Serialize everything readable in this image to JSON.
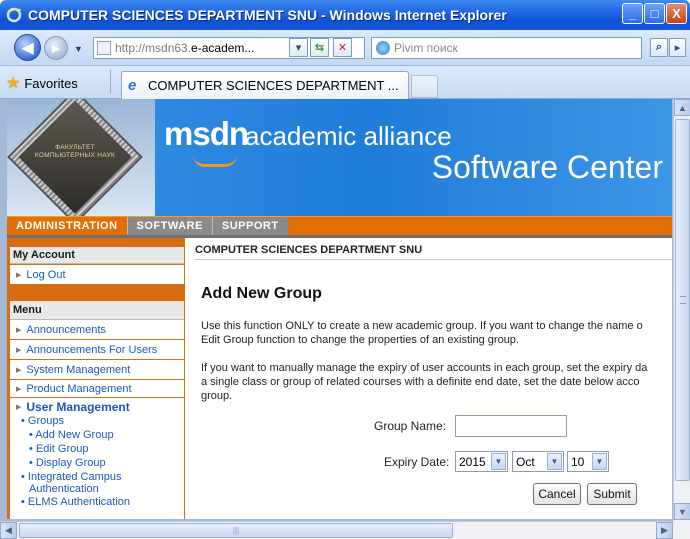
{
  "window": {
    "title": "COMPUTER SCIENCES DEPARTMENT SNU - Windows Internet Explorer",
    "buttons": [
      "_",
      "□",
      "X"
    ]
  },
  "nav": {
    "address_prefix": "http://msdn63.",
    "address_host": "e-academ...",
    "search_placeholder": "Pivim поиск"
  },
  "favorites": {
    "label": "Favorites",
    "tab_title": "COMPUTER SCIENCES DEPARTMENT ..."
  },
  "banner": {
    "logo_text": "ФАКУЛЬТЕТ КОМПЬЮТЕРНЫХ НАУК",
    "msdn": "msdn",
    "academic_alliance": "academic alliance",
    "software_center": "Software Center"
  },
  "topnav": {
    "items": [
      "ADMINISTRATION",
      "SOFTWARE",
      "SUPPORT"
    ]
  },
  "sidebar": {
    "my_account_header": "My Account",
    "logout": "Log Out",
    "menu_header": "Menu",
    "items": [
      "Announcements",
      "Announcements For Users",
      "System Management",
      "Product Management"
    ],
    "user_management": "User Management",
    "groups": "• Groups",
    "group_links": [
      "• Add New Group",
      "• Edit Group",
      "• Display Group"
    ],
    "integrated_campus": [
      "• Integrated Campus",
      "Authentication"
    ],
    "elms": "• ELMS Authentication"
  },
  "main": {
    "breadcrumb": "COMPUTER SCIENCES DEPARTMENT SNU",
    "title": "Add New Group",
    "para1_line1": "Use this function ONLY to create a new academic group. If you want to change the name o",
    "para1_line2": "Edit Group function to change the properties of an existing group.",
    "para2_line1": "If you want to manually manage the expiry of user accounts in each group, set the expiry da",
    "para2_line2": "a single class or group of related courses with a definite end date, set the date below acco",
    "para2_line3": "group.",
    "group_name_label": "Group Name:",
    "group_name_value": "",
    "expiry_label": "Expiry Date:",
    "year": "2015",
    "month": "Oct",
    "day": "10",
    "cancel": "Cancel",
    "submit": "Submit"
  },
  "colors": {
    "accent_orange": "#e26f06",
    "link_blue": "#1b58b6",
    "banner_blue": "#1f7cd9"
  }
}
